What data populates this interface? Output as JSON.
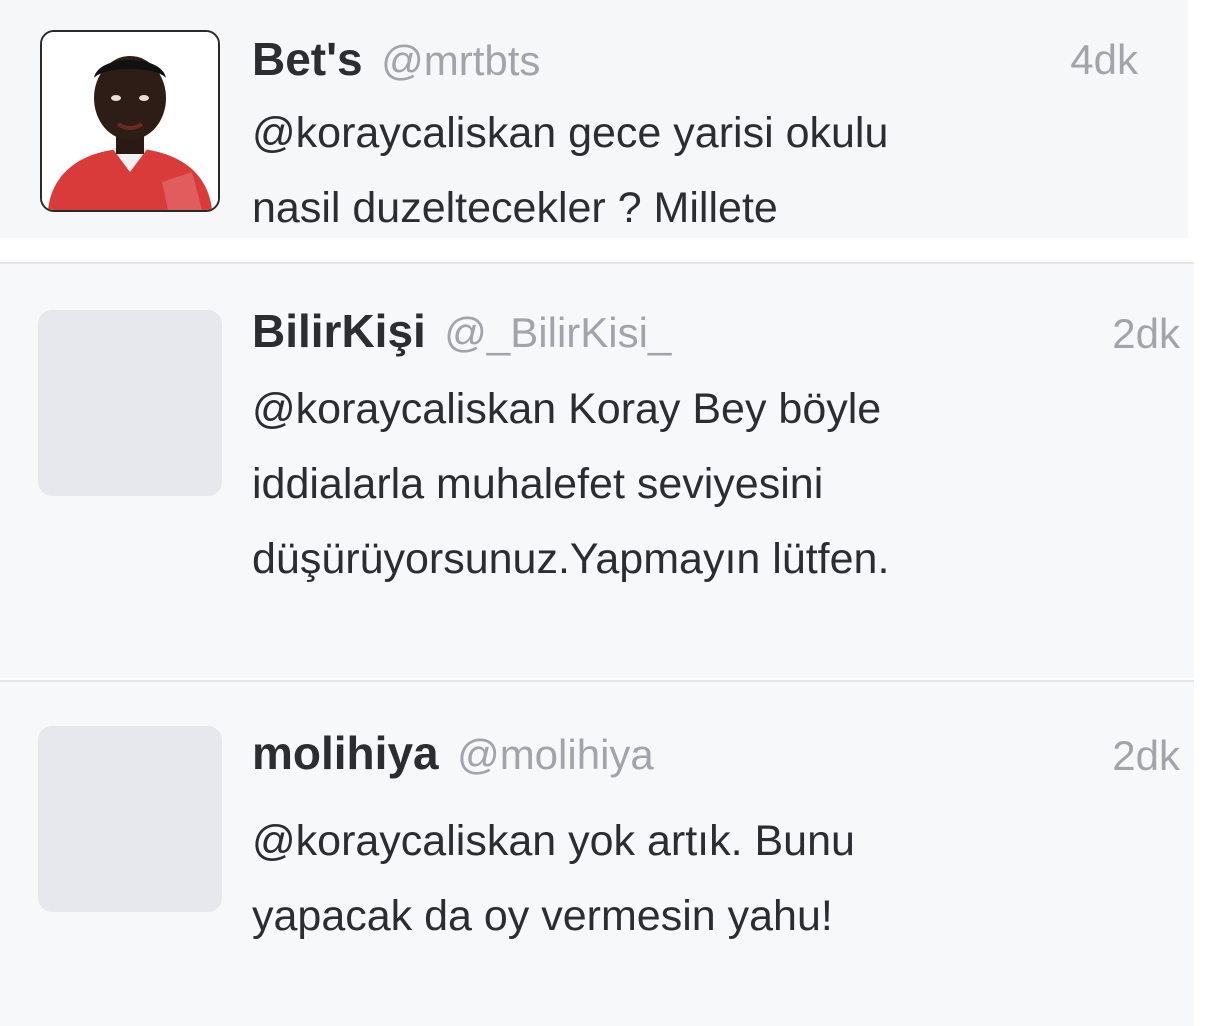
{
  "tweets": [
    {
      "name": "Bet's",
      "handle": "@mrtbts",
      "time": "4dk",
      "lines": [
        "@koraycaliskan gece yarisi okulu",
        "nasil duzeltecekler ? Millete"
      ]
    },
    {
      "name": "BilirKişi",
      "handle": "@_BilirKisi_",
      "time": "2dk",
      "lines": [
        "@koraycaliskan Koray Bey böyle",
        "iddialarla muhalefet seviyesini",
        "düşürüyorsunuz.Yapmayın lütfen."
      ]
    },
    {
      "name": "molihiya",
      "handle": "@molihiya",
      "time": "2dk",
      "lines": [
        "@koraycaliskan yok artık. Bunu",
        "yapacak da oy vermesin yahu!"
      ]
    }
  ],
  "colors": {
    "name": "#2b2d31",
    "muted": "#a1a5ab",
    "background": "#f7f8fa",
    "placeholder_avatar": "#e6e8ee",
    "avatar_shirt": "#d93a3a"
  }
}
